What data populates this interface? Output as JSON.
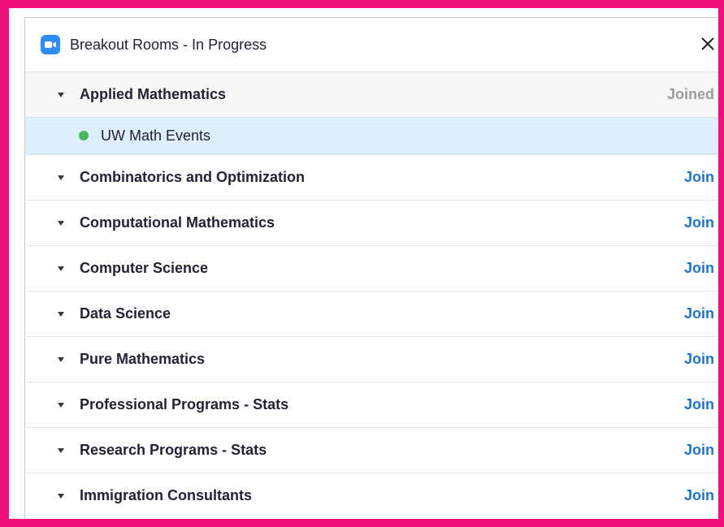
{
  "window": {
    "title": "Breakout Rooms - In Progress",
    "app_icon": "zoom-camera-icon",
    "close_icon": "close-icon"
  },
  "rooms": [
    {
      "label": "Applied Mathematics",
      "action": "Joined",
      "joined": true,
      "participants": [
        {
          "name": "UW Math Events",
          "status": "online"
        }
      ]
    },
    {
      "label": "Combinatorics and Optimization",
      "action": "Join"
    },
    {
      "label": "Computational Mathematics",
      "action": "Join"
    },
    {
      "label": "Computer Science",
      "action": "Join"
    },
    {
      "label": "Data Science",
      "action": "Join"
    },
    {
      "label": "Pure Mathematics",
      "action": "Join"
    },
    {
      "label": "Professional Programs - Stats",
      "action": "Join"
    },
    {
      "label": "Research Programs - Stats",
      "action": "Join"
    },
    {
      "label": "Immigration Consultants",
      "action": "Join"
    }
  ],
  "colors": {
    "frame_border": "#f0117a",
    "join_link": "#1a73d9",
    "joined_text": "#9b9b9b",
    "selected_row": "#ddeefc",
    "online_dot": "#4bb85a",
    "app_icon": "#2d8cff"
  }
}
